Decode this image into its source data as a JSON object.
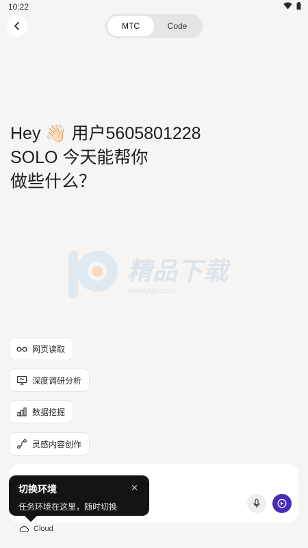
{
  "status_bar": {
    "time": "10:22",
    "icons": [
      "wifi-icon",
      "battery-icon"
    ]
  },
  "header": {
    "back_icon": "chevron-left-icon",
    "tabs": [
      {
        "label": "MTC",
        "active": true
      },
      {
        "label": "Code",
        "active": false
      }
    ]
  },
  "greeting": {
    "line1_prefix": "Hey",
    "line1_emoji": "👋🏻",
    "line1_user": "用户5605801228",
    "line2": "SOLO 今天能帮你",
    "line3": "做些什么？"
  },
  "watermark": {
    "title": "精品下载",
    "url": "www.j9p.com"
  },
  "suggestions": [
    {
      "label": "网页读取",
      "icon": "glasses-icon"
    },
    {
      "label": "深度调研分析",
      "icon": "presentation-icon"
    },
    {
      "label": "数据挖掘",
      "icon": "bar-chart-icon"
    },
    {
      "label": "灵感内容创作",
      "icon": "path-icon"
    }
  ],
  "input": {
    "mic_icon": "microphone-icon",
    "send_icon": "send-icon"
  },
  "tooltip": {
    "title": "切换环境",
    "description": "任务环境在这里，随时切换",
    "close": "×"
  },
  "environment": {
    "label": "Cloud",
    "icon": "cloud-icon"
  },
  "colors": {
    "accent": "#4a2bb8",
    "background": "#f6f5f3",
    "tooltip": "#141414"
  }
}
